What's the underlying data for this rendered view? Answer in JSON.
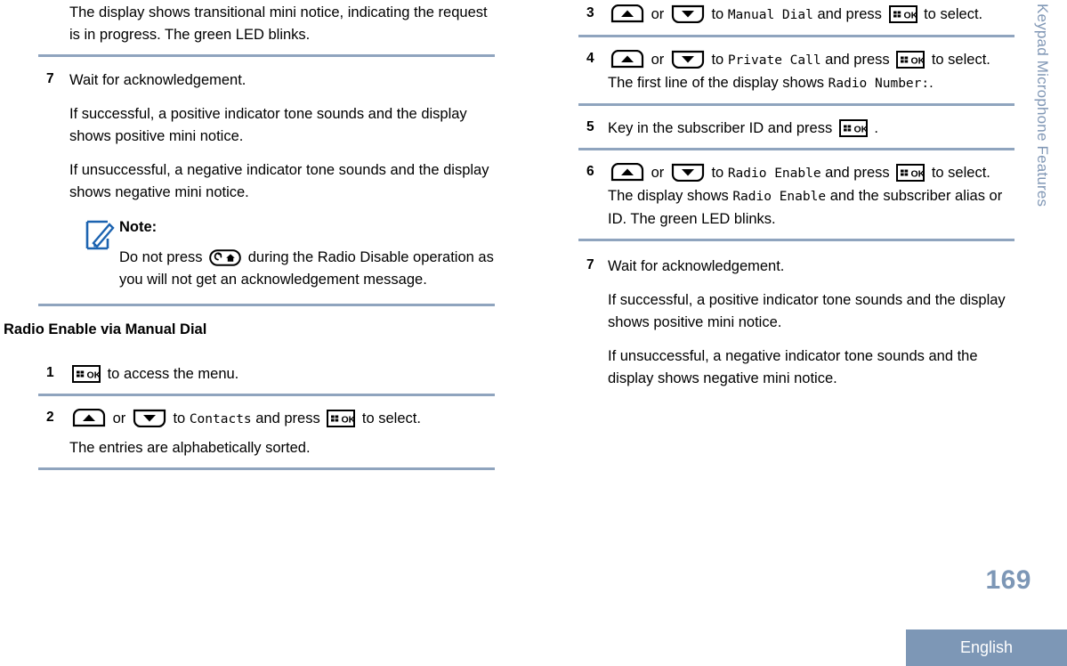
{
  "sidebar": {
    "vertical_title": "Keypad Microphone Features",
    "accent_color": "#7d97b6"
  },
  "footer": {
    "page_number": "169",
    "language": "English"
  },
  "left_column": {
    "blocks": [
      {
        "kind": "continuation",
        "paragraphs": [
          "The display shows transitional mini notice, indicating the request is in progress. The green LED blinks."
        ]
      },
      {
        "kind": "step",
        "number": "7",
        "paragraphs": [
          "Wait for acknowledgement.",
          "If successful, a positive indicator tone sounds and the display shows positive mini notice.",
          "If unsuccessful, a negative indicator tone sounds and the display shows negative mini notice."
        ],
        "note": {
          "icon": "note-pencil-icon",
          "title": "Note:",
          "text_before_key": "Do not press",
          "key": "back-home-key",
          "text_after_key": "during the Radio Disable operation as you will not get an acknowledgement message."
        }
      },
      {
        "kind": "heading",
        "text": "Radio Enable via Manual Dial"
      },
      {
        "kind": "step",
        "number": "1",
        "lead_key": "menu-ok-key",
        "lead_text": "to access the menu."
      },
      {
        "kind": "step",
        "number": "2",
        "nav": {
          "up_key": "up-arrow-key",
          "or": "or",
          "down_key": "down-arrow-key",
          "to": "to",
          "target": "Contacts",
          "and_press": "and press",
          "ok_key": "menu-ok-key",
          "tail": "to select."
        },
        "paragraphs": [
          "The entries are alphabetically sorted."
        ]
      }
    ]
  },
  "right_column": {
    "blocks": [
      {
        "kind": "step",
        "number": "3",
        "nav": {
          "up_key": "up-arrow-key",
          "or": "or",
          "down_key": "down-arrow-key",
          "to": "to",
          "target": "Manual Dial",
          "and_press": "and press",
          "ok_key": "menu-ok-key",
          "tail": "to select."
        }
      },
      {
        "kind": "step",
        "number": "4",
        "nav": {
          "up_key": "up-arrow-key",
          "or": "or",
          "down_key": "down-arrow-key",
          "to": "to",
          "target": "Private Call",
          "and_press": "and press",
          "ok_key": "menu-ok-key",
          "tail": "to select."
        },
        "display_line": {
          "before": "The first line of the display shows",
          "value": "Radio Number:",
          "after": "."
        }
      },
      {
        "kind": "step",
        "number": "5",
        "key_in": {
          "before": "Key in the subscriber ID and press",
          "ok_key": "menu-ok-key",
          "after": "."
        }
      },
      {
        "kind": "step",
        "number": "6",
        "nav": {
          "up_key": "up-arrow-key",
          "or": "or",
          "down_key": "down-arrow-key",
          "to": "to",
          "target": "Radio Enable",
          "and_press": "and press",
          "ok_key": "menu-ok-key",
          "tail": "to select."
        },
        "display_line": {
          "before": "The display shows",
          "value": "Radio Enable",
          "after": "and the subscriber alias or ID. The green LED blinks."
        }
      },
      {
        "kind": "step",
        "number": "7",
        "paragraphs": [
          "Wait for acknowledgement.",
          "If successful, a positive indicator tone sounds and the display shows positive mini notice.",
          "If unsuccessful, a negative indicator tone sounds and the display shows negative mini notice."
        ]
      }
    ]
  }
}
